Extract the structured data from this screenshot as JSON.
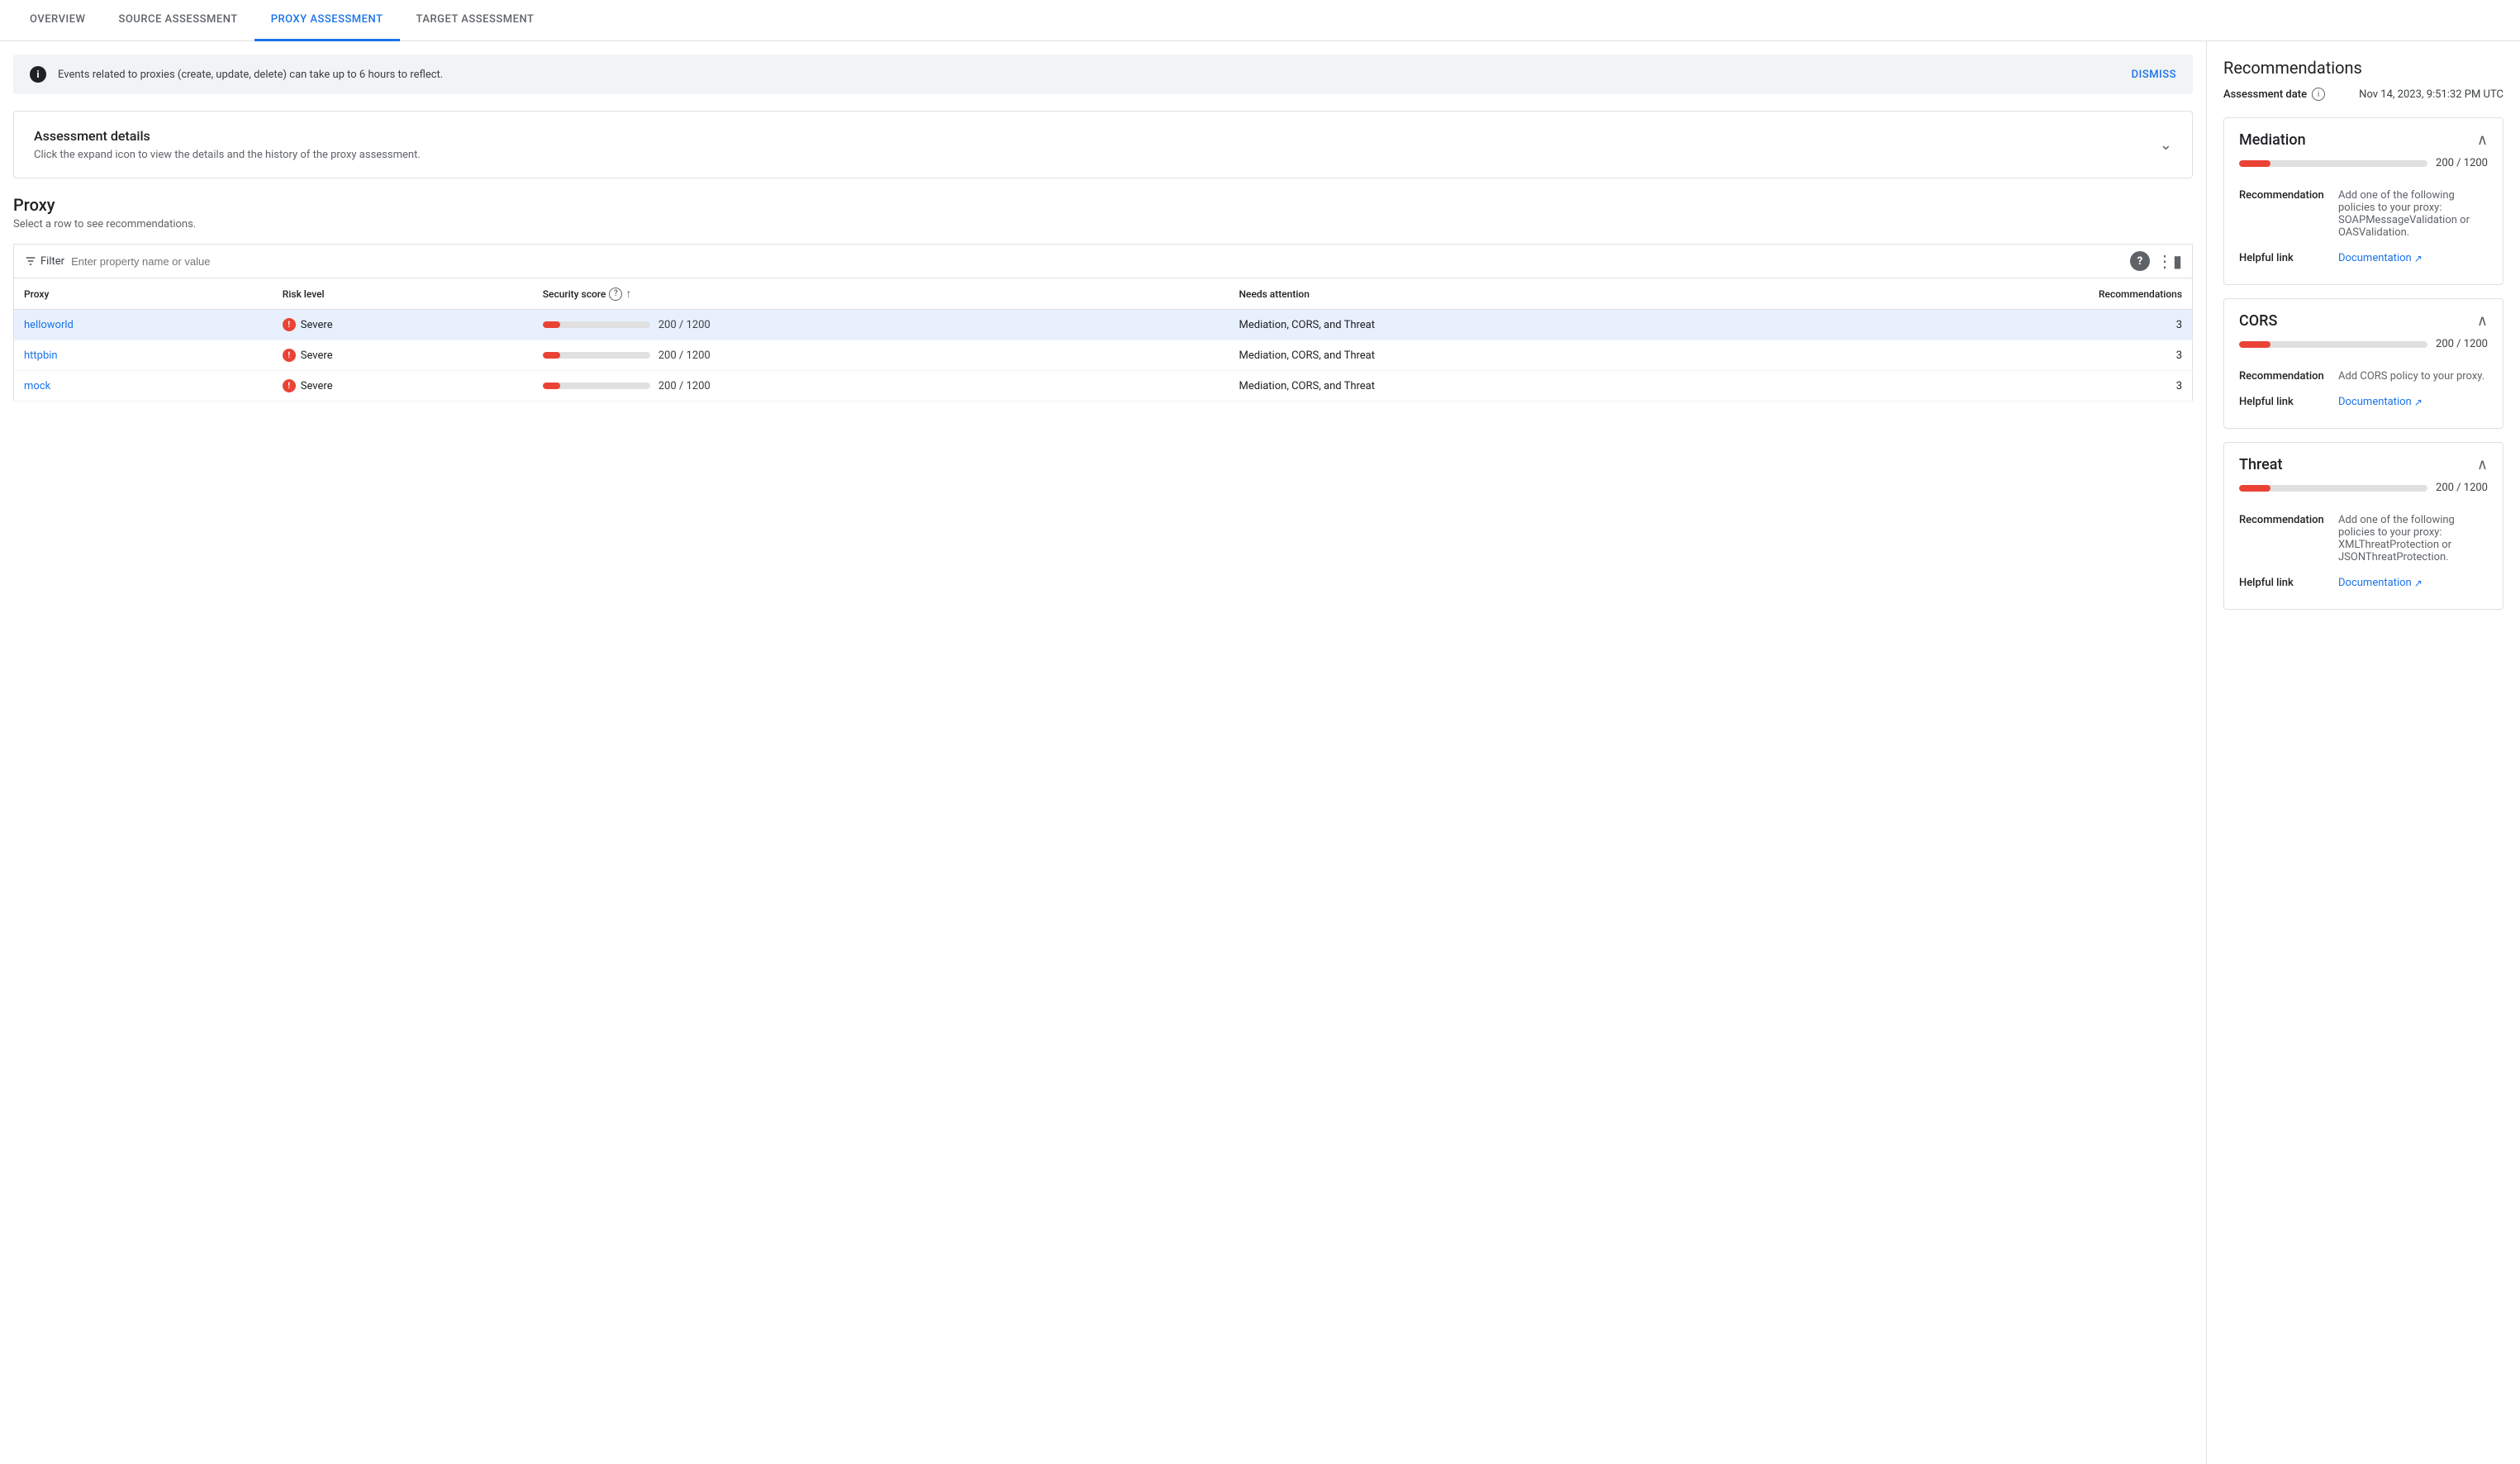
{
  "tabs": [
    {
      "id": "overview",
      "label": "OVERVIEW",
      "active": false
    },
    {
      "id": "source",
      "label": "SOURCE ASSESSMENT",
      "active": false
    },
    {
      "id": "proxy",
      "label": "PROXY ASSESSMENT",
      "active": true
    },
    {
      "id": "target",
      "label": "TARGET ASSESSMENT",
      "active": false
    }
  ],
  "banner": {
    "text": "Events related to proxies (create, update, delete) can take up to 6 hours to reflect.",
    "dismiss_label": "DISMISS"
  },
  "assessment_details": {
    "title": "Assessment details",
    "subtitle": "Click the expand icon to view the details and the history of the proxy assessment."
  },
  "proxy_section": {
    "title": "Proxy",
    "subtitle": "Select a row to see recommendations.",
    "filter_placeholder": "Enter property name or value",
    "columns": {
      "proxy": "Proxy",
      "risk_level": "Risk level",
      "security_score": "Security score",
      "needs_attention": "Needs attention",
      "recommendations": "Recommendations"
    },
    "rows": [
      {
        "proxy": "helloworld",
        "risk_level": "Severe",
        "score_current": "200",
        "score_max": "1200",
        "score_display": "200 / 1200",
        "needs_attention": "Mediation, CORS, and Threat",
        "recommendations": "3",
        "selected": true
      },
      {
        "proxy": "httpbin",
        "risk_level": "Severe",
        "score_current": "200",
        "score_max": "1200",
        "score_display": "200 / 1200",
        "needs_attention": "Mediation, CORS, and Threat",
        "recommendations": "3",
        "selected": false
      },
      {
        "proxy": "mock",
        "risk_level": "Severe",
        "score_current": "200",
        "score_max": "1200",
        "score_display": "200 / 1200",
        "needs_attention": "Mediation, CORS, and Threat",
        "recommendations": "3",
        "selected": false
      }
    ]
  },
  "right_panel": {
    "title": "Recommendations",
    "assessment_date_label": "Assessment date",
    "assessment_date_value": "Nov 14, 2023, 9:51:32 PM UTC",
    "cards": [
      {
        "id": "mediation",
        "title": "Mediation",
        "score_display": "200 / 1200",
        "score_pct": 16.7,
        "recommendation_label": "Recommendation",
        "recommendation_text": "Add one of the following policies to your proxy: SOAPMessageValidation or OASValidation.",
        "helpful_link_label": "Helpful link",
        "helpful_link_text": "Documentation",
        "helpful_link_url": "#"
      },
      {
        "id": "cors",
        "title": "CORS",
        "score_display": "200 / 1200",
        "score_pct": 16.7,
        "recommendation_label": "Recommendation",
        "recommendation_text": "Add CORS policy to your proxy.",
        "helpful_link_label": "Helpful link",
        "helpful_link_text": "Documentation",
        "helpful_link_url": "#"
      },
      {
        "id": "threat",
        "title": "Threat",
        "score_display": "200 / 1200",
        "score_pct": 16.7,
        "recommendation_label": "Recommendation",
        "recommendation_text": "Add one of the following policies to your proxy: XMLThreatProtection or JSONThreatProtection.",
        "helpful_link_label": "Helpful link",
        "helpful_link_text": "Documentation",
        "helpful_link_url": "#"
      }
    ]
  },
  "colors": {
    "severe": "#ea4335",
    "blue": "#1a73e8",
    "selected_row_bg": "#e8f0fe"
  }
}
